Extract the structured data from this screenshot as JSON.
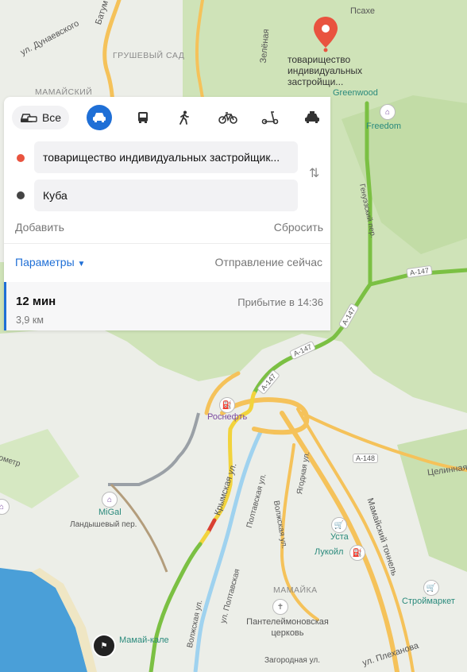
{
  "map": {
    "labels": {
      "pshakhe": "Псахе",
      "dunaevsky": "ул. Дунаевского",
      "batumi": "Батум",
      "grushevy": "ГРУШЕВЫЙ САД",
      "mamaysky": "МАМАЙСКИЙ",
      "zelenaya": "Зелёная",
      "greenwood": "Greenwood",
      "freedom": "Freedom",
      "genoese": "Генуэзский пер.",
      "rosneft": "Роснефть",
      "miGal": "MiGal",
      "landysh": "Ландышевый пер.",
      "krymskaya": "Крымская ул.",
      "poltavskaya": "Полтавская ул.",
      "poltavskaya2": "ул. Полтавская",
      "volzhskaya": "Волжская ул.",
      "volzhskaya2": "Волжская ул.",
      "yagodnaya": "Ягодная ул.",
      "tselinnaya": "Целинная",
      "usta": "Уста",
      "lukoil": "Лукойл",
      "tunnel": "Мамайский тоннель",
      "stroymarket": "Строймаркет",
      "mamaika": "МАМАЙКА",
      "church": "Пантелеймоновская церковь",
      "mamaykale": "Мамай-кале",
      "zagorodnaya": "Загородная ул.",
      "plekhanova": "ул. Плеханова",
      "ometr": "ометр"
    },
    "road_badges": {
      "a147_1": "A-147",
      "a147_2": "A-147",
      "a147_3": "A-147",
      "a147_4": "A-147",
      "a148": "A-148"
    },
    "destination_label": "товарищество индивидуальных застройщи...",
    "destination_label_line1": "товарищество",
    "destination_label_line2": "индивидуальных",
    "destination_label_line3": "застройщи...",
    "colors": {
      "route_green": "#7bc043",
      "route_yellow": "#f2d33c",
      "route_red": "#d94032",
      "road_orange": "#f5c25a",
      "water": "#4a9fd8",
      "forest": "#c7dfae",
      "accent": "#1f6fd6"
    }
  },
  "panel": {
    "modes": {
      "all_label": "Все",
      "icons": [
        "car-icon",
        "bus-icon",
        "walk-icon",
        "bicycle-icon",
        "scooter-icon",
        "taxi-icon"
      ]
    },
    "from_value": "товарищество индивидуальных застройщик...",
    "to_value": "Куба",
    "add_label": "Добавить",
    "reset_label": "Сбросить",
    "params_label": "Параметры",
    "departure_label": "Отправление сейчас",
    "result": {
      "duration": "12 мин",
      "distance": "3,9 км",
      "arrival": "Прибытие в 14:36"
    }
  }
}
